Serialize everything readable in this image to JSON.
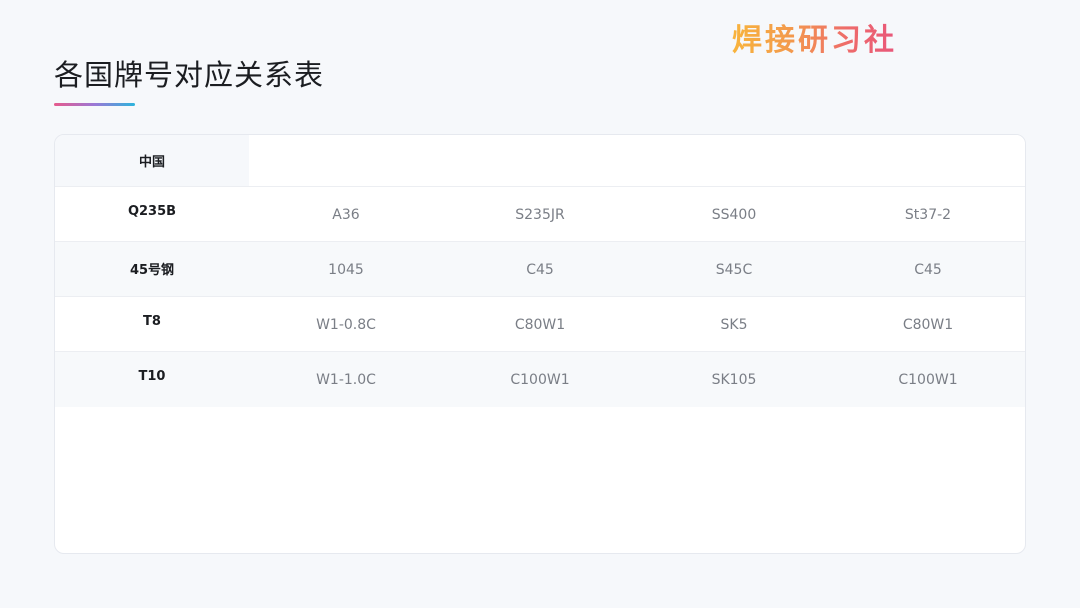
{
  "brand": {
    "logo_text": "焊接研习社"
  },
  "page": {
    "title": "各国牌号对应关系表"
  },
  "table": {
    "header_label": "中国",
    "rows": [
      {
        "label": "Q235B",
        "cells": [
          "A36",
          "S235JR",
          "SS400",
          "St37-2"
        ]
      },
      {
        "label": "45号钢",
        "cells": [
          "1045",
          "C45",
          "S45C",
          "C45"
        ]
      },
      {
        "label": "T8",
        "cells": [
          "W1-0.8C",
          "C80W1",
          "SK5",
          "C80W1"
        ]
      },
      {
        "label": "T10",
        "cells": [
          "W1-1.0C",
          "C100W1",
          "SK105",
          "C100W1"
        ]
      }
    ]
  },
  "colors": {
    "background": "#f6f8fb",
    "logo_gradient": [
      "#f8b43c",
      "#e8567a"
    ],
    "underline_gradient": [
      "#e65a8c",
      "#2cb4dc"
    ]
  }
}
